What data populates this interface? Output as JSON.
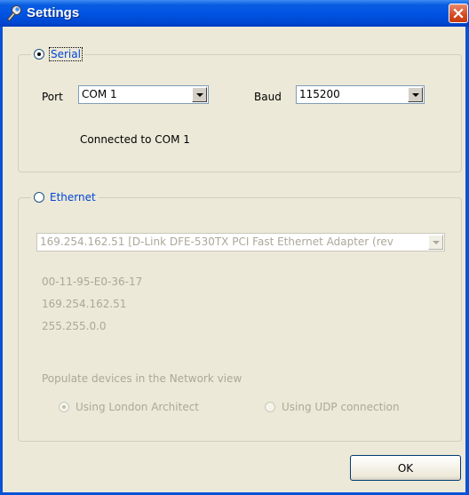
{
  "window": {
    "title": "Settings"
  },
  "serial": {
    "label": "Serial",
    "selected": true,
    "port_label": "Port",
    "port_value": "COM 1",
    "baud_label": "Baud",
    "baud_value": "115200",
    "status": "Connected to COM  1"
  },
  "ethernet": {
    "label": "Ethernet",
    "selected": false,
    "adapter_value": "169.254.162.51 [D-Link DFE-530TX PCI Fast Ethernet Adapter (rev",
    "mac": "00-11-95-E0-36-17",
    "ip": "169.254.162.51",
    "mask": "255.255.0.0",
    "populate_label": "Populate devices in the Network view",
    "option_london": "Using London Architect",
    "option_udp": "Using UDP connection"
  },
  "buttons": {
    "ok": "OK"
  },
  "colors": {
    "titlebar": "#0054e3",
    "legend_text": "#0046d5",
    "disabled_text": "#aca899",
    "face": "#ece9d8"
  }
}
